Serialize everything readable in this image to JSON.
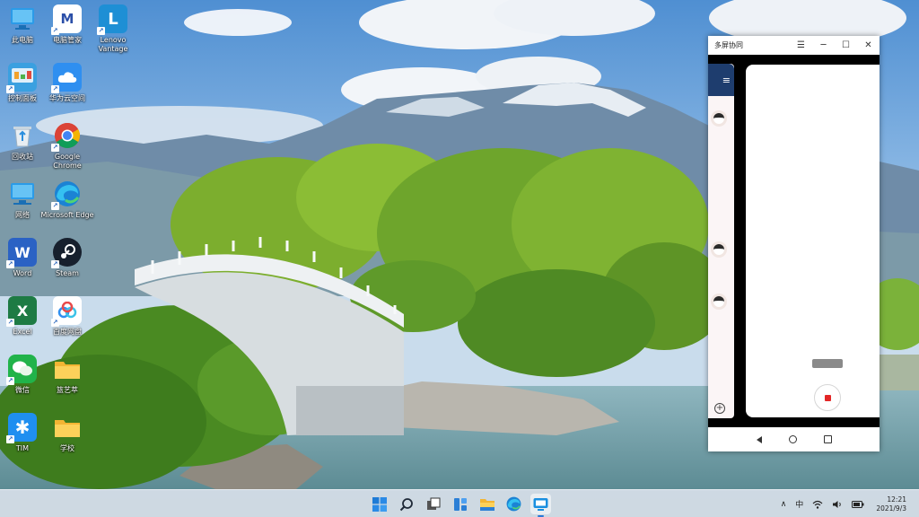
{
  "desktop": {
    "icons": [
      {
        "label": "此电脑",
        "icon": "this-pc-icon"
      },
      {
        "label": "电脑管家",
        "icon": "pc-manager-icon"
      },
      {
        "label": "Lenovo Vantage",
        "icon": "lenovo-vantage-icon"
      },
      {
        "label": "控制面板",
        "icon": "control-panel-icon"
      },
      {
        "label": "华为云空间",
        "icon": "huawei-cloud-icon"
      },
      {
        "label": "回收站",
        "icon": "recycle-bin-icon"
      },
      {
        "label": "Google Chrome",
        "icon": "chrome-icon"
      },
      {
        "label": "网络",
        "icon": "network-icon"
      },
      {
        "label": "Microsoft Edge",
        "icon": "edge-icon"
      },
      {
        "label": "Word",
        "icon": "word-icon"
      },
      {
        "label": "Steam",
        "icon": "steam-icon"
      },
      {
        "label": "Excel",
        "icon": "excel-icon"
      },
      {
        "label": "百度网盘",
        "icon": "baidu-netdisk-icon"
      },
      {
        "label": "微信",
        "icon": "wechat-icon"
      },
      {
        "label": "篮艺萃",
        "icon": "folder-icon"
      },
      {
        "label": "TIM",
        "icon": "tim-icon"
      },
      {
        "label": "学校",
        "icon": "folder-icon"
      }
    ]
  },
  "phone_window": {
    "title": "多屏协同",
    "controls": {
      "menu": "☰",
      "minimize": "─",
      "maximize": "☐",
      "close": "✕"
    },
    "menu_glyph": "≡",
    "add_glyph": "+"
  },
  "taskbar": {
    "apps": [
      "start-icon",
      "search-icon",
      "task-view-icon",
      "widgets-icon",
      "file-explorer-icon",
      "edge-icon",
      "multi-screen-icon"
    ],
    "tray": {
      "overflow": "∧",
      "ime": "中",
      "time": "12:21",
      "date": "2021/9/3"
    }
  },
  "colors": {
    "taskbar": "#d6dee8",
    "accent": "#2a78d6",
    "record": "#e32626",
    "phone_header": "#1e3d6e"
  }
}
